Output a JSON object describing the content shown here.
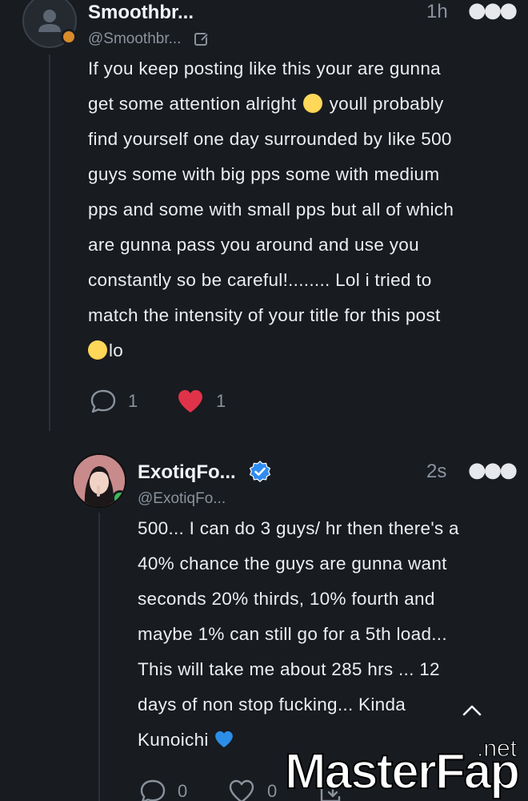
{
  "post": {
    "user_name": "Smoothbr...",
    "handle": "@Smoothbr...",
    "time": "1h",
    "lines": [
      "If you keep posting like this your are gunna",
      "get some attention alright",
      "youll probably",
      "find yourself one day surrounded by like 500",
      "guys some with big pps some with medium",
      "pps and some with small pps but all of which",
      "are gunna pass you around and use you",
      "constantly so be careful!........ Lol i tried to",
      "match the intensity of your title for this post",
      "lo"
    ],
    "reply_count": "1",
    "like_count": "1",
    "avatar_icon": "default-user-icon",
    "status_color": "#d98a2b",
    "like_color": "#e0334a"
  },
  "reply": {
    "user_name": "ExotiqFo...",
    "handle": "@ExotiqFo...",
    "time": "2s",
    "verified_icon": "verified-check-icon",
    "lines": [
      "500... I can do 3 guys/ hr then there's a",
      "40% chance the guys are gunna want",
      "seconds 20% thirds, 10% fourth and",
      "maybe 1% can still go for a 5th load...",
      "This will take me about 285 hrs ... 12",
      "days of non stop fucking... Kinda",
      "Kunoichi"
    ],
    "reply_count": "0",
    "like_count": "0",
    "status_color": "#3dbb5c",
    "verified_color": "#2f8cf0"
  },
  "watermark": {
    "brand_main": "MasterFap",
    "brand_tld": ".net"
  }
}
